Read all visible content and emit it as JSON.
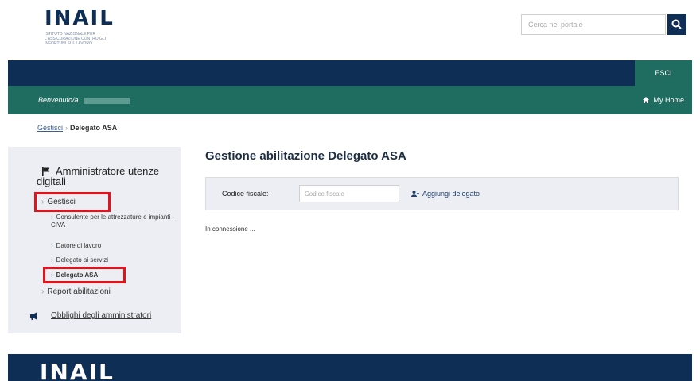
{
  "header": {
    "logo_text": "INAIL",
    "logo_subtitle": "ISTITUTO NAZIONALE PER L'ASSICURAZIONE CONTRO GLI INFORTUNI SUL LAVORO",
    "search_placeholder": "Cerca nel portale"
  },
  "topbar": {
    "logout_label": "ESCI"
  },
  "userbar": {
    "welcome_label": "Benvenuto/a",
    "home_label": "My Home"
  },
  "breadcrumb": {
    "parent": "Gestisci",
    "current": "Delegato ASA"
  },
  "sidebar": {
    "title": "Amministratore utenze digitali",
    "gestisci": "Gestisci",
    "sub_items": [
      "Consulente per le attrezzature e impianti - CIVA",
      "Datore di lavoro",
      "Delegato ai servizi",
      "Delegato ASA"
    ],
    "report": "Report abilitazioni",
    "obblighi": "Obblighi degli amministratori"
  },
  "main": {
    "title": "Gestione abilitazione Delegato ASA",
    "cf_label": "Codice fiscale:",
    "cf_placeholder": "Codice fiscale",
    "add_label": "Aggiungi delegato",
    "status": "In connessione ..."
  },
  "footer": {
    "logo_text": "INAIL"
  },
  "colors": {
    "navy": "#0e2e55",
    "green": "#1f6d61",
    "highlight_red": "#e0141a",
    "panel_gray": "#eceef3"
  }
}
